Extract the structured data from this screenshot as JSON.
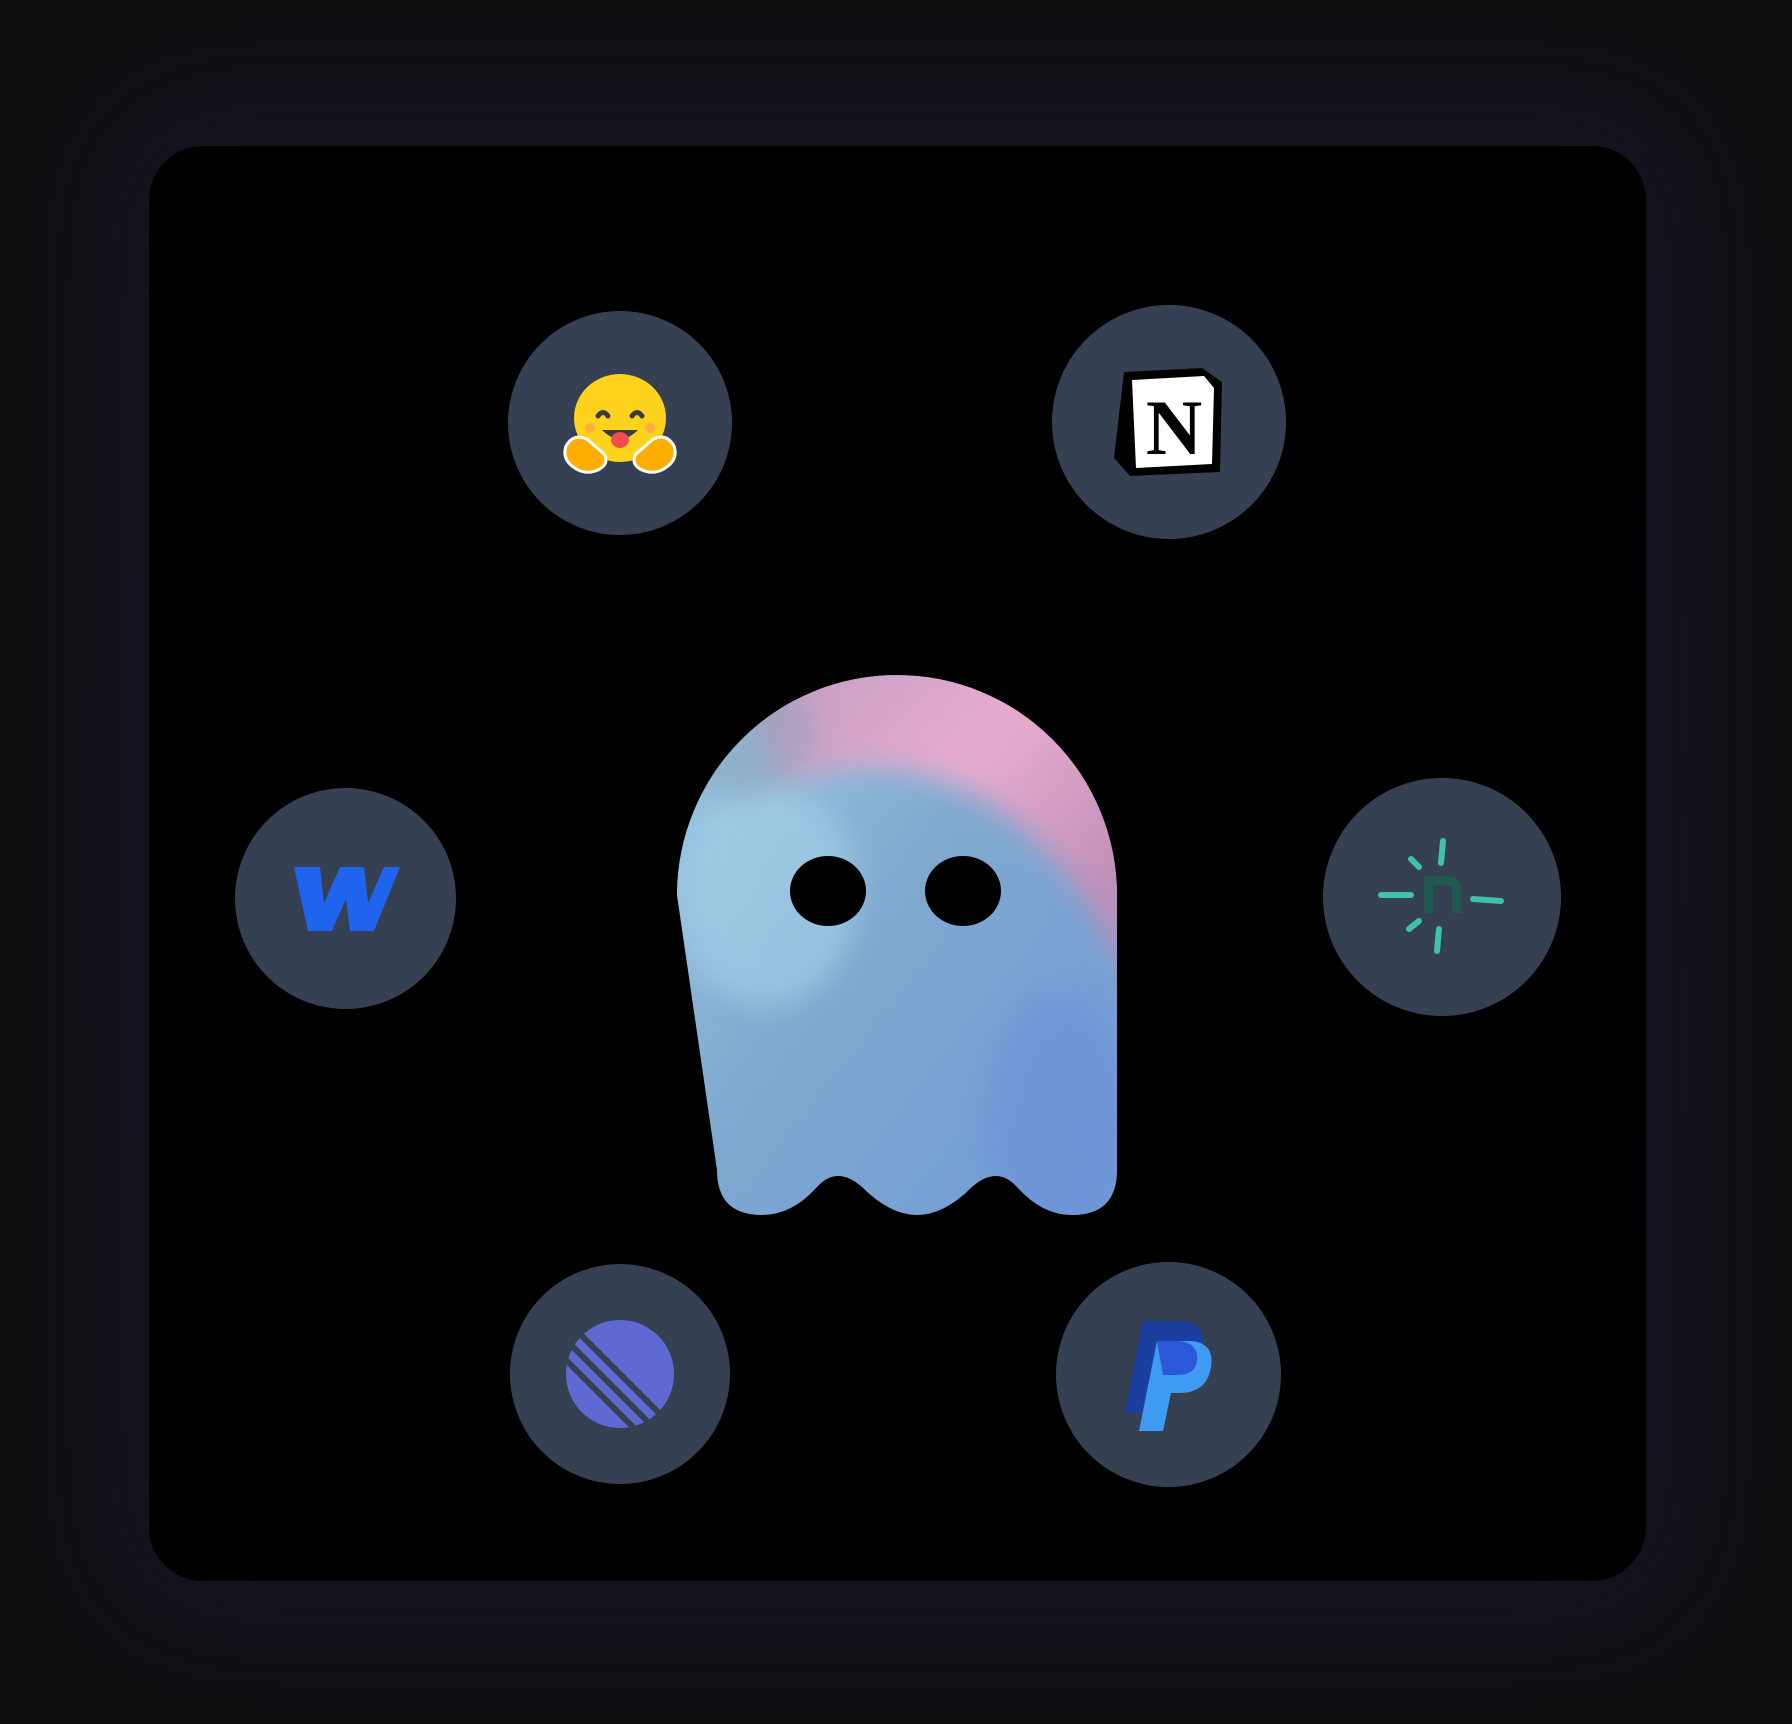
{
  "app": {
    "center_icon": "ghost-icon",
    "integrations": [
      {
        "name": "hugging-face",
        "icon": "hugging-face-icon"
      },
      {
        "name": "notion",
        "icon": "notion-icon"
      },
      {
        "name": "webflow",
        "icon": "webflow-icon"
      },
      {
        "name": "nexus",
        "icon": "nexus-icon"
      },
      {
        "name": "linear",
        "icon": "linear-icon"
      },
      {
        "name": "paypal",
        "icon": "paypal-icon"
      }
    ]
  },
  "notion_logo": {
    "letter": "N"
  },
  "colors": {
    "page_background": "#111114",
    "card_background": "#000000",
    "orb_background": "#354153",
    "ghost_blue": "#7fb0d8",
    "ghost_pink": "#e6a8cf",
    "webflow_blue": "#1f63ee",
    "linear_purple": "#5e6ad2",
    "paypal_dark": "#1b3fa0",
    "paypal_light": "#3f9bf2",
    "nexus_teal": "#3fc1b0",
    "hf_yellow": "#ffd21e"
  }
}
